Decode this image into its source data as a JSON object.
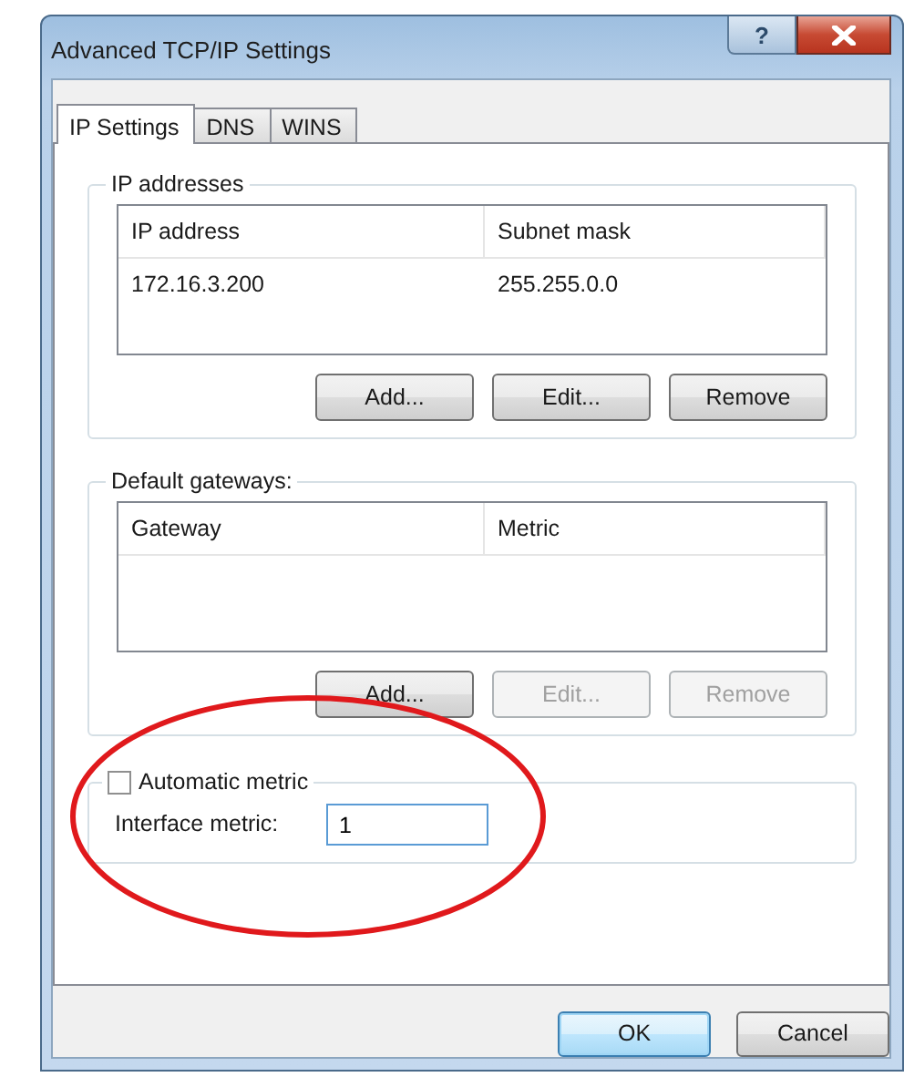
{
  "window": {
    "title": "Advanced TCP/IP Settings",
    "help_button": "?"
  },
  "tabs": [
    {
      "label": "IP Settings",
      "selected": true
    },
    {
      "label": "DNS",
      "selected": false
    },
    {
      "label": "WINS",
      "selected": false
    }
  ],
  "ip_addresses": {
    "label": "IP addresses",
    "columns": [
      "IP address",
      "Subnet mask"
    ],
    "rows": [
      [
        "172.16.3.200",
        "255.255.0.0"
      ]
    ],
    "buttons": [
      {
        "label": "Add...",
        "disabled": false
      },
      {
        "label": "Edit...",
        "disabled": false
      },
      {
        "label": "Remove",
        "disabled": false
      }
    ]
  },
  "default_gateways": {
    "label": "Default gateways:",
    "columns": [
      "Gateway",
      "Metric"
    ],
    "buttons": [
      {
        "label": "Add...",
        "disabled": false
      },
      {
        "label": "Edit...",
        "disabled": true
      },
      {
        "label": "Remove",
        "disabled": true
      }
    ]
  },
  "automatic_metric": {
    "label": "Automatic metric",
    "checked": false
  },
  "interface_metric": {
    "label": "Interface metric:",
    "value": "1"
  },
  "buttons": [
    {
      "label": "OK",
      "default": true
    },
    {
      "label": "Cancel",
      "default": false
    }
  ]
}
